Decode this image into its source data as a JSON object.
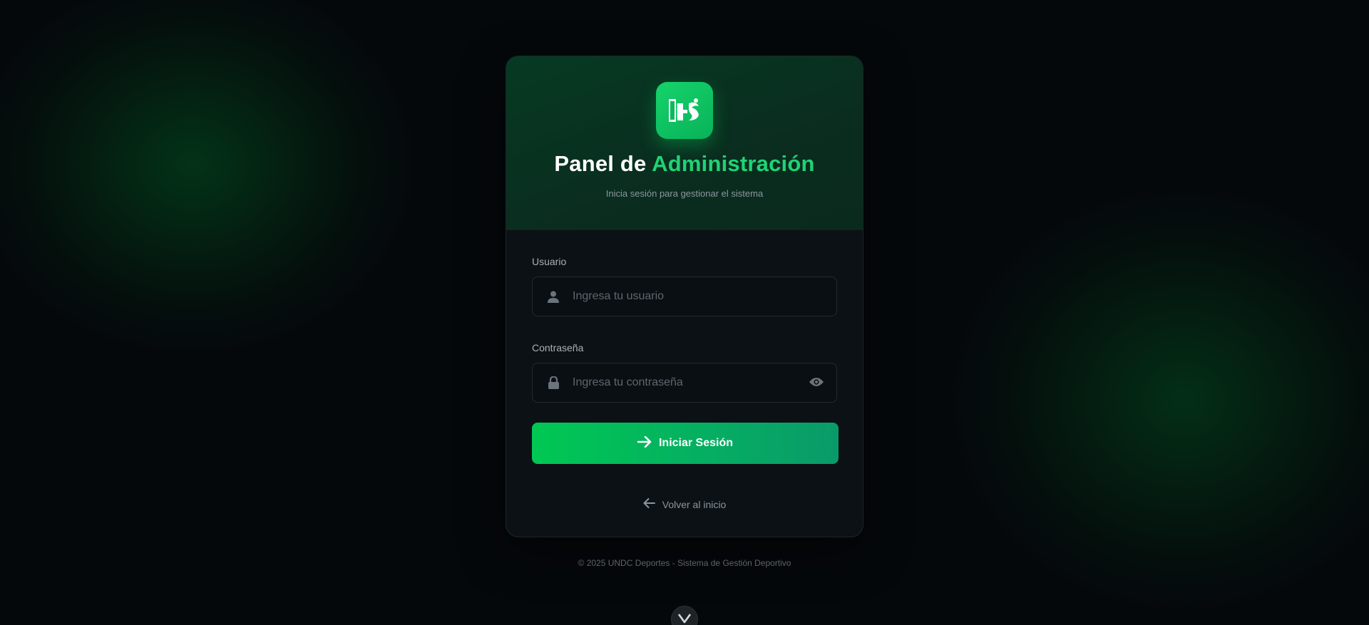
{
  "header": {
    "logo_icon": "undc-deportes-logo-icon",
    "title_main": "Panel de",
    "title_accent": "Administración",
    "subtitle": "Inicia sesión para gestionar el sistema"
  },
  "form": {
    "username": {
      "label": "Usuario",
      "placeholder": "Ingresa tu usuario",
      "value": "",
      "icon": "user-icon"
    },
    "password": {
      "label": "Contraseña",
      "placeholder": "Ingresa tu contraseña",
      "value": "",
      "icon": "lock-icon",
      "toggle_icon": "eye-icon"
    },
    "submit_label": "Iniciar Sesión",
    "submit_icon": "arrow-right-icon"
  },
  "back_link": {
    "label": "Volver al inicio",
    "icon": "arrow-left-icon"
  },
  "footer": {
    "text": "© 2025 UNDC Deportes - Sistema de Gestión Deportivo"
  },
  "colors": {
    "accent": "#1fd374",
    "button_start": "#00c853",
    "button_end": "#0a9a6a",
    "background": "#05080b"
  }
}
